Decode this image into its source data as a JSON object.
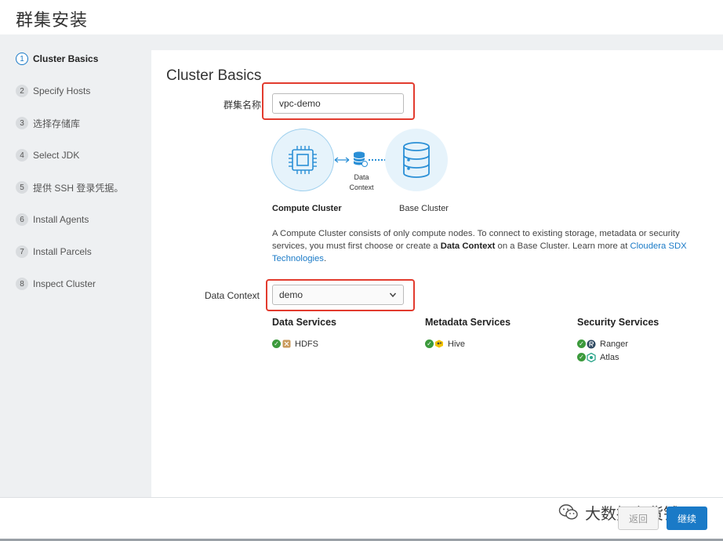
{
  "page": {
    "title": "群集安装"
  },
  "sidebar": {
    "steps": [
      {
        "num": "1",
        "label": "Cluster Basics"
      },
      {
        "num": "2",
        "label": "Specify Hosts"
      },
      {
        "num": "3",
        "label": "选择存储库"
      },
      {
        "num": "4",
        "label": "Select JDK"
      },
      {
        "num": "5",
        "label": "提供 SSH 登录凭据。"
      },
      {
        "num": "6",
        "label": "Install Agents"
      },
      {
        "num": "7",
        "label": "Install Parcels"
      },
      {
        "num": "8",
        "label": "Inspect Cluster"
      }
    ]
  },
  "main": {
    "section_title": "Cluster Basics",
    "cluster_name": {
      "label": "群集名称",
      "value": "vpc-demo"
    },
    "diagram": {
      "compute_label": "Compute Cluster",
      "base_label": "Base Cluster",
      "context_line1": "Data",
      "context_line2": "Context"
    },
    "description": {
      "text1": "A Compute Cluster consists of only compute nodes. To connect to existing storage, metadata or security services, you must first choose or create a ",
      "bold": "Data Context",
      "text2": " on a Base Cluster. Learn more at ",
      "link": "Cloudera SDX Technologies",
      "text3": "."
    },
    "data_context": {
      "label": "Data Context",
      "selected": "demo"
    },
    "services": {
      "data": {
        "title": "Data Services",
        "items": [
          "HDFS"
        ]
      },
      "metadata": {
        "title": "Metadata Services",
        "items": [
          "Hive"
        ]
      },
      "security": {
        "title": "Security Services",
        "items": [
          "Ranger",
          "Atlas"
        ]
      }
    }
  },
  "footer": {
    "back_label": "返回",
    "next_label": "继续",
    "watermark": "大数据杂货铺"
  },
  "colors": {
    "accent": "#1a7ac7",
    "highlight": "#e23b2e",
    "success": "#3c9a3c"
  }
}
